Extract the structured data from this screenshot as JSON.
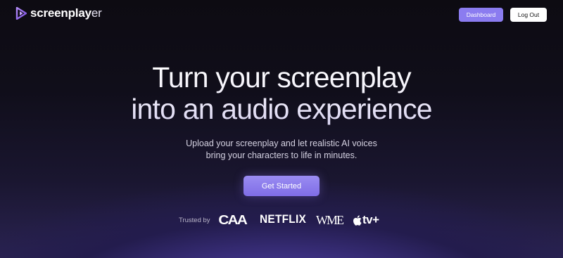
{
  "header": {
    "logo_text_main": "screenplay",
    "logo_text_tail": "er",
    "logo_icon": "play-icon",
    "dashboard_label": "Dashboard",
    "logout_label": "Log Out"
  },
  "hero": {
    "headline_line1": "Turn your screenplay",
    "headline_line2": "into an audio experience",
    "subtext_line1": "Upload your screenplay and let realistic AI voices",
    "subtext_line2": "bring your characters to life in minutes.",
    "cta_label": "Get Started"
  },
  "trusted": {
    "label": "Trusted by",
    "brands": [
      "CAA",
      "NETFLIX",
      "WME",
      "tv+"
    ],
    "appletv_icon": "apple-icon"
  },
  "colors": {
    "accent": "#8b7cf0",
    "background_dark": "#0d0b12",
    "glow": "#6a55c2"
  }
}
